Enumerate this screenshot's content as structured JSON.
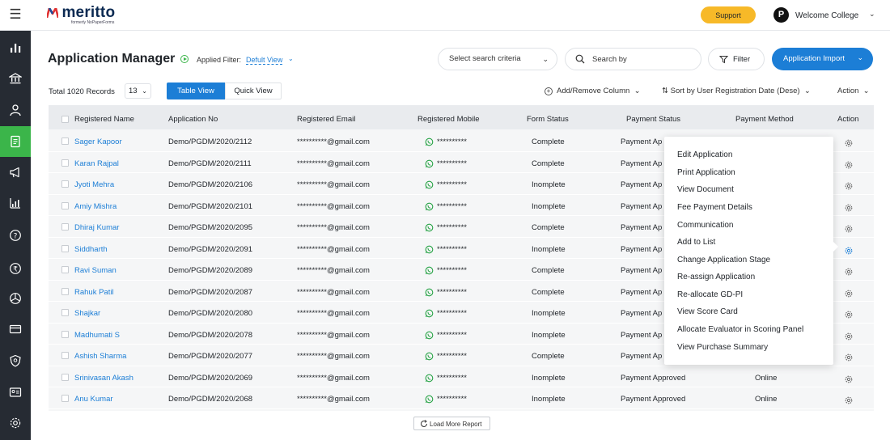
{
  "app": {
    "logo_text": "meritto",
    "logo_sub": "formerly NoPaperForms",
    "support_label": "Support",
    "avatar_letter": "P",
    "welcome": "Welcome College"
  },
  "header": {
    "title": "Application Manager",
    "applied_filter_label": "Applied Filter:",
    "applied_filter_value": "Defult View",
    "search_criteria": "Select search criteria",
    "search_placeholder": "Search by",
    "filter_label": "Filter",
    "import_label": "Application Import"
  },
  "toolbar": {
    "total_records": "Total 1020 Records",
    "page_size": "13",
    "tab_table": "Table View",
    "tab_quick": "Quick View",
    "add_remove": "Add/Remove Column",
    "sort_by": "Sort by User Registration Date (Dese)",
    "action": "Action"
  },
  "table": {
    "columns": [
      "Registered Name",
      "Application No",
      "Registered Email",
      "Registered Mobile",
      "Form Status",
      "Payment Status",
      "Payment Method",
      "Action"
    ],
    "rows": [
      {
        "name": "Sager Kapoor",
        "app_no": "Demo/PGDM/2020/2112",
        "email": "**********@gmail.com",
        "mobile": "**********",
        "form_status": "Complete",
        "payment_status": "Payment Ap",
        "payment_method": ""
      },
      {
        "name": "Karan Rajpal",
        "app_no": "Demo/PGDM/2020/2111",
        "email": "**********@gmail.com",
        "mobile": "**********",
        "form_status": "Complete",
        "payment_status": "Payment Ap",
        "payment_method": ""
      },
      {
        "name": "Jyoti Mehra",
        "app_no": "Demo/PGDM/2020/2106",
        "email": "**********@gmail.com",
        "mobile": "**********",
        "form_status": "Inomplete",
        "payment_status": "Payment Ap",
        "payment_method": ""
      },
      {
        "name": "Amiy Mishra",
        "app_no": "Demo/PGDM/2020/2101",
        "email": "**********@gmail.com",
        "mobile": "**********",
        "form_status": "Inomplete",
        "payment_status": "Payment Ap",
        "payment_method": ""
      },
      {
        "name": "Dhiraj Kumar",
        "app_no": "Demo/PGDM/2020/2095",
        "email": "**********@gmail.com",
        "mobile": "**********",
        "form_status": "Complete",
        "payment_status": "Payment Ap",
        "payment_method": ""
      },
      {
        "name": "Siddharth",
        "app_no": "Demo/PGDM/2020/2091",
        "email": "**********@gmail.com",
        "mobile": "**********",
        "form_status": "Inomplete",
        "payment_status": "Payment Ap",
        "payment_method": ""
      },
      {
        "name": "Ravi Suman",
        "app_no": "Demo/PGDM/2020/2089",
        "email": "**********@gmail.com",
        "mobile": "**********",
        "form_status": "Complete",
        "payment_status": "Payment Ap",
        "payment_method": ""
      },
      {
        "name": "Rahuk Patil",
        "app_no": "Demo/PGDM/2020/2087",
        "email": "**********@gmail.com",
        "mobile": "**********",
        "form_status": "Complete",
        "payment_status": "Payment Ap",
        "payment_method": ""
      },
      {
        "name": "Shajkar",
        "app_no": "Demo/PGDM/2020/2080",
        "email": "**********@gmail.com",
        "mobile": "**********",
        "form_status": "Inomplete",
        "payment_status": "Payment Ap",
        "payment_method": ""
      },
      {
        "name": "Madhumati S",
        "app_no": "Demo/PGDM/2020/2078",
        "email": "**********@gmail.com",
        "mobile": "**********",
        "form_status": "Inomplete",
        "payment_status": "Payment Ap",
        "payment_method": ""
      },
      {
        "name": "Ashish Sharma",
        "app_no": "Demo/PGDM/2020/2077",
        "email": "**********@gmail.com",
        "mobile": "**********",
        "form_status": "Complete",
        "payment_status": "Payment Ap",
        "payment_method": ""
      },
      {
        "name": "Srinivasan Akash",
        "app_no": "Demo/PGDM/2020/2069",
        "email": "**********@gmail.com",
        "mobile": "**********",
        "form_status": "Inomplete",
        "payment_status": "Payment Approved",
        "payment_method": "Online"
      },
      {
        "name": "Anu Kumar",
        "app_no": "Demo/PGDM/2020/2068",
        "email": "**********@gmail.com",
        "mobile": "**********",
        "form_status": "Inomplete",
        "payment_status": "Payment Approved",
        "payment_method": "Online"
      }
    ]
  },
  "context_menu": {
    "items": [
      "Edit Application",
      "Print Application",
      "View Document",
      "Fee Payment Details",
      "Communication",
      "Add to List",
      "Change Application Stage",
      "Re-assign Application",
      "Re-allocate GD-PI",
      "View Score Card",
      "Allocate Evaluator in Scoring Panel",
      "View Purchase Summary"
    ]
  },
  "footer": {
    "load_more": "Load More Report"
  },
  "nav": {
    "icons": [
      "bar-chart-icon",
      "bank-icon",
      "user-icon",
      "document-icon",
      "megaphone-icon",
      "analytics-icon",
      "help-icon",
      "rupee-icon",
      "pie-chart-icon",
      "card-icon",
      "shield-icon",
      "id-card-icon",
      "gear-icon"
    ]
  },
  "colors": {
    "brand_blue": "#1c7ed6",
    "active_green": "#3bb54a",
    "support_yellow": "#f7b928",
    "nav_dark": "#262b33"
  }
}
